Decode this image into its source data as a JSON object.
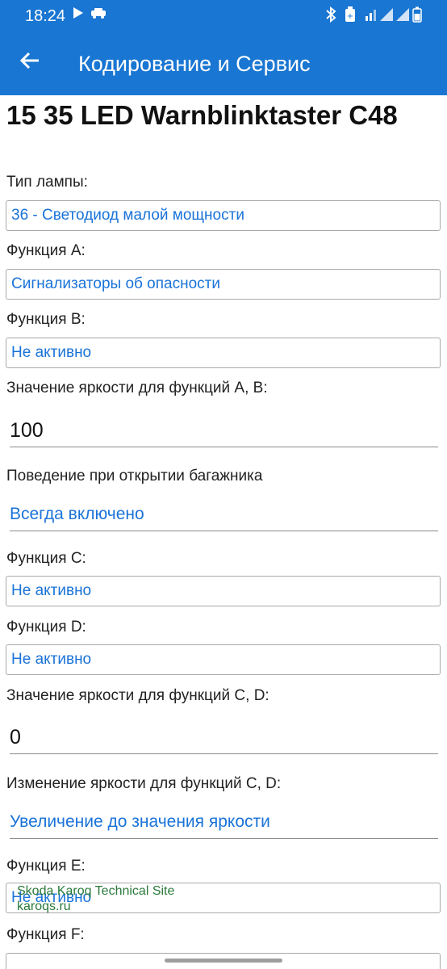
{
  "status_bar": {
    "time": "18:24",
    "icons": [
      "play-icon",
      "car-icon",
      "bluetooth-icon",
      "battery-saver-icon",
      "wifi-signal-icon",
      "signal-icon",
      "signal-icon",
      "battery-icon"
    ]
  },
  "app_bar": {
    "back_icon": "arrow-left-icon",
    "title": "Кодирование и Сервис",
    "color": "#1976d2"
  },
  "page_title": "15 35 LED Warnblinktaster C48",
  "fields": {
    "lamp_type": {
      "label": "Тип лампы:",
      "value": "36 - Светодиод малой мощности"
    },
    "function_a": {
      "label": "Функция A:",
      "value": "Сигнализаторы об опасности"
    },
    "function_b": {
      "label": "Функция B:",
      "value": "Не активно"
    },
    "brightness_ab": {
      "label": "Значение яркости для функций A, B:",
      "value": "100"
    },
    "trunk_behavior": {
      "label": "Поведение при открытии багажника",
      "value": "Всегда включено"
    },
    "function_c": {
      "label": "Функция C:",
      "value": "Не активно"
    },
    "function_d": {
      "label": "Функция D:",
      "value": "Не активно"
    },
    "brightness_cd": {
      "label": "Значение яркости для функций C, D:",
      "value": "0"
    },
    "brightness_change_cd": {
      "label": "Изменение яркости для функций C, D:",
      "value": "Увеличение до значения яркости"
    },
    "function_e": {
      "label": "Функция E:",
      "value": "Не активно"
    },
    "function_f": {
      "label": "Функция F:"
    }
  },
  "watermark": {
    "line1": "Skoda Karoq Technical Site",
    "line2": "karoqs.ru"
  },
  "accent_color": "#1a73d8"
}
